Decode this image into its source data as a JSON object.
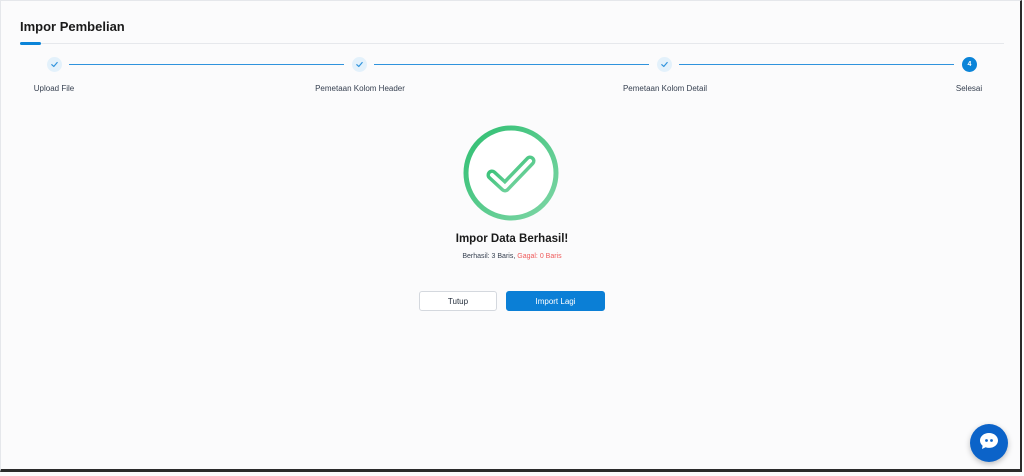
{
  "page": {
    "title": "Impor Pembelian"
  },
  "stepper": {
    "steps": [
      {
        "label": "Upload File",
        "status": "done"
      },
      {
        "label": "Pemetaan Kolom Header",
        "status": "done"
      },
      {
        "label": "Pemetaan Kolom Detail",
        "status": "done"
      },
      {
        "label": "Selesai",
        "status": "active",
        "number": "4"
      }
    ]
  },
  "result": {
    "title": "Impor Data Berhasil!",
    "success_text": "Berhasil: 3 Baris,",
    "fail_text": "Gagal: 0 Baris"
  },
  "actions": {
    "close_label": "Tutup",
    "import_again_label": "Import Lagi"
  },
  "icons": {
    "success": "check-circle-icon",
    "chat": "chat-bubble-icon"
  },
  "colors": {
    "primary": "#0b84d8",
    "success": "#3cc27a",
    "error": "#ef5b5b"
  }
}
